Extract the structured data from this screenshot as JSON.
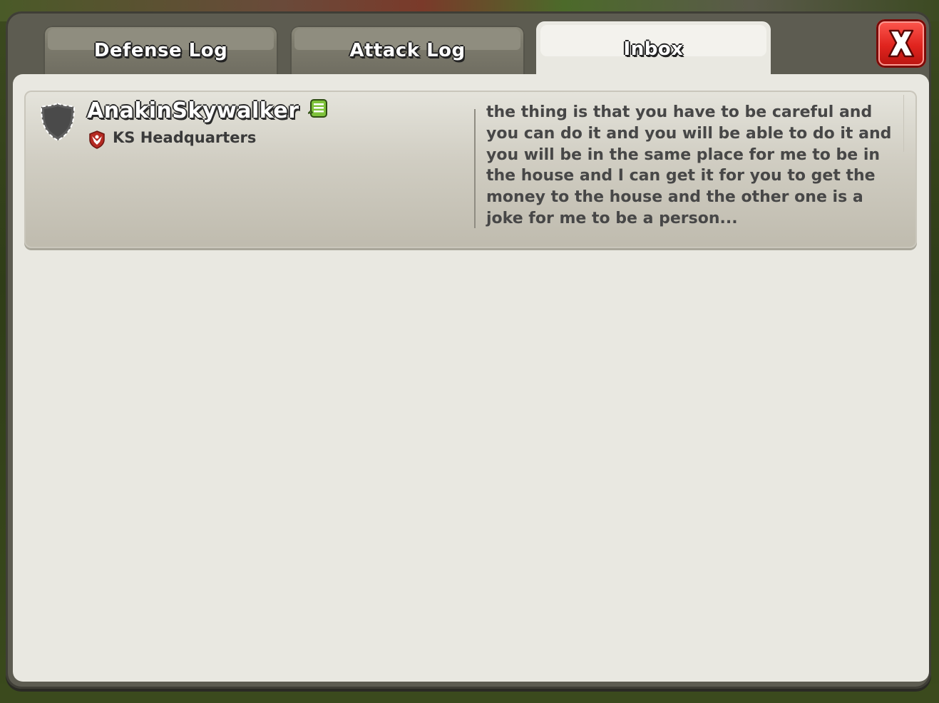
{
  "tabs": [
    {
      "label": "Defense Log",
      "active": false
    },
    {
      "label": "Attack Log",
      "active": false
    },
    {
      "label": "Inbox",
      "active": true
    }
  ],
  "close_button": {
    "label": "X"
  },
  "messages": [
    {
      "sender": "AnakinSkywalker",
      "clan": "KS Headquarters",
      "preview": "the thing is that you have to be careful and you can do it and you will be able to do it and you will be in the same place for me to be in the house and I can get it for you to get the money to the house and the other one is a joke for me to be a person...",
      "shield_icon": "shield-icon",
      "league_icon": "chat-bubble-icon",
      "clan_icon": "clan-badge-icon"
    }
  ],
  "colors": {
    "close_button": "#e0241e",
    "panel": "#e9e8e1",
    "frame": "#5d5c51"
  }
}
